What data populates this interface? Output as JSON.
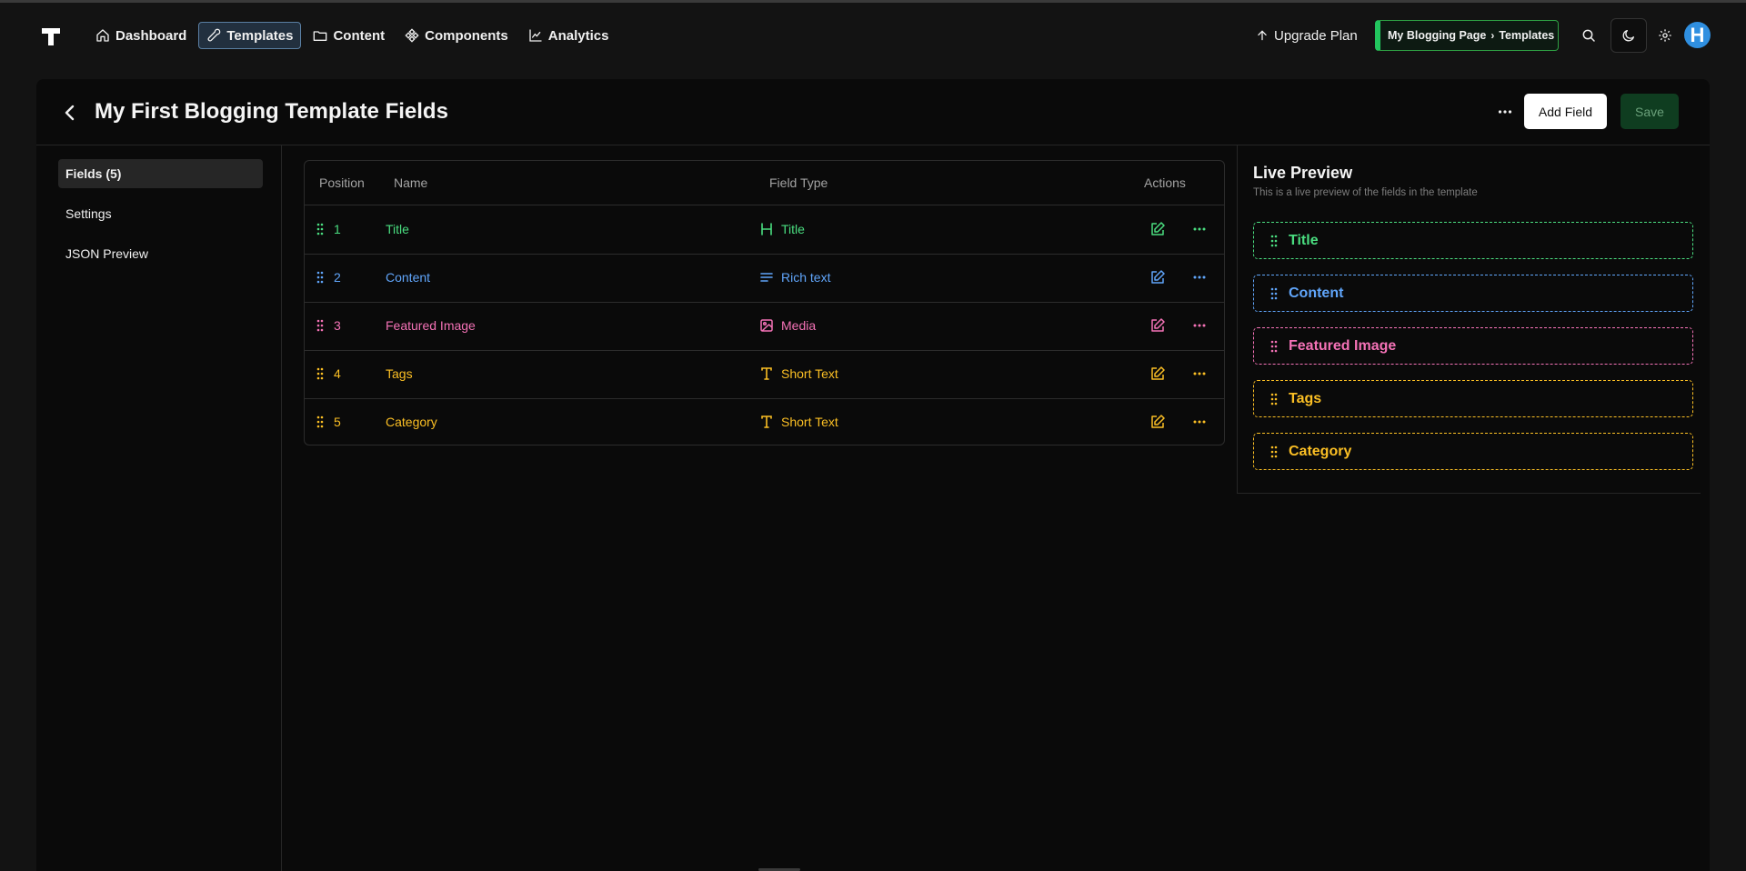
{
  "nav": {
    "items": [
      {
        "label": "Dashboard",
        "icon": "home-icon"
      },
      {
        "label": "Templates",
        "icon": "wrench-icon",
        "active": true
      },
      {
        "label": "Content",
        "icon": "folder-icon"
      },
      {
        "label": "Components",
        "icon": "component-icon"
      },
      {
        "label": "Analytics",
        "icon": "chart-icon"
      }
    ],
    "upgrade_label": "Upgrade Plan",
    "breadcrumb": {
      "project": "My Blogging Page",
      "section": "Templates"
    },
    "avatar_letter": "H"
  },
  "page": {
    "title": "My First Blogging Template Fields",
    "add_field_label": "Add Field",
    "save_label": "Save"
  },
  "sidebar": {
    "items": [
      {
        "label": "Fields (5)",
        "active": true
      },
      {
        "label": "Settings"
      },
      {
        "label": "JSON Preview"
      }
    ]
  },
  "table": {
    "headers": [
      "Position",
      "Name",
      "Field Type",
      "Actions"
    ],
    "rows": [
      {
        "position": "1",
        "name": "Title",
        "type": "Title",
        "type_icon": "heading-icon",
        "color": "#4ade80"
      },
      {
        "position": "2",
        "name": "Content",
        "type": "Rich text",
        "type_icon": "rich-text-icon",
        "color": "#60a5fa"
      },
      {
        "position": "3",
        "name": "Featured Image",
        "type": "Media",
        "type_icon": "image-icon",
        "color": "#f472b6"
      },
      {
        "position": "4",
        "name": "Tags",
        "type": "Short Text",
        "type_icon": "text-icon",
        "color": "#fbbf24"
      },
      {
        "position": "5",
        "name": "Category",
        "type": "Short Text",
        "type_icon": "text-icon",
        "color": "#fbbf24"
      }
    ]
  },
  "preview": {
    "title": "Live Preview",
    "subtitle": "This is a live preview of the fields in the template",
    "fields": [
      {
        "label": "Title",
        "color": "#4ade80"
      },
      {
        "label": "Content",
        "color": "#60a5fa"
      },
      {
        "label": "Featured Image",
        "color": "#f472b6"
      },
      {
        "label": "Tags",
        "color": "#fbbf24"
      },
      {
        "label": "Category",
        "color": "#fbbf24"
      }
    ]
  },
  "colors": {
    "accent_green": "#22c55e",
    "background": "#131313",
    "panel": "#0a0a0a"
  }
}
